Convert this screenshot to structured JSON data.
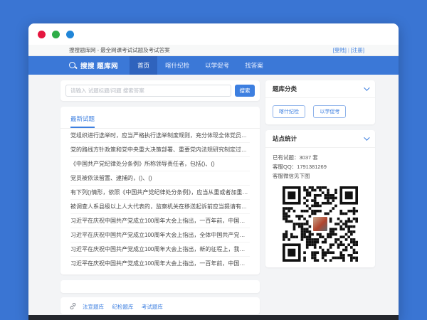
{
  "window": {
    "page_title": "搜搜题库网 - 最全网课考试试题及考试答案",
    "login_label": "[登陆]",
    "separator": "|",
    "register_label": "[注册]"
  },
  "nav": {
    "logo_text": "搜搜 题库网",
    "items": [
      {
        "label": "首页"
      },
      {
        "label": "喀什纪检"
      },
      {
        "label": "以学促考"
      },
      {
        "label": "找答案"
      }
    ]
  },
  "search": {
    "placeholder": "请输入 试题标题/问题 搜索答案",
    "button_label": "搜索"
  },
  "latest": {
    "tab_label": "最新试题",
    "questions": [
      "党组织进行选举时，应当严格执行选举制度规则，充分体现全体党员的意志。",
      "党的路线方针政策和党中央重大决策部署、重要党内法规研究制定过程中，应当广泛征求...",
      "《中国共产党纪律处分条例》所称领导责任者，包括()、()",
      "党员被依法留置、逮捕的，()、()",
      "有下列()情形，依照《中国共产党纪律处分条例》，应当从重或者加重处分。()",
      "被调查人系县级以上人大代表的，监察机关在移送起诉前应当提请有关机关依法()其人大代...",
      "习近平在庆祝中国共产党成立100周年大会上指出，一百年前，中国共产党成立时只有()党...",
      "习近平在庆祝中国共产党成立100周年大会上指出，全体中国共产党员！党中央号召你们，(...",
      "习近平在庆祝中国共产党成立100周年大会上指出，新的征程上，我们必须紧紧依靠人民创...",
      "习近平在庆祝中国共产党成立100周年大会上指出，一百年前，中国共产党的先驱们创建了..."
    ]
  },
  "sidebar": {
    "category": {
      "title": "题库分类",
      "buttons": [
        {
          "label": "喀什纪检"
        },
        {
          "label": "以学促考"
        }
      ]
    },
    "stats": {
      "title": "站点统计",
      "lines": [
        "已有试题：3037 套",
        "客服QQ：1791381269",
        "客服微信见下图"
      ],
      "qr": "wechat-customer-service-qr"
    }
  },
  "footer": {
    "links": [
      {
        "label": "法宣题库"
      },
      {
        "label": "纪检题库"
      },
      {
        "label": "考试题库"
      }
    ]
  },
  "colors": {
    "page_background": "#3a75d3",
    "nav_blue": "#3b78d7",
    "nav_active_blue": "#2f63bd",
    "accent_blue": "#3d7fe0",
    "dot_red": "#e5173f",
    "dot_green": "#2ead47",
    "dot_blue": "#2186d8",
    "dark_footer": "#24272d"
  }
}
